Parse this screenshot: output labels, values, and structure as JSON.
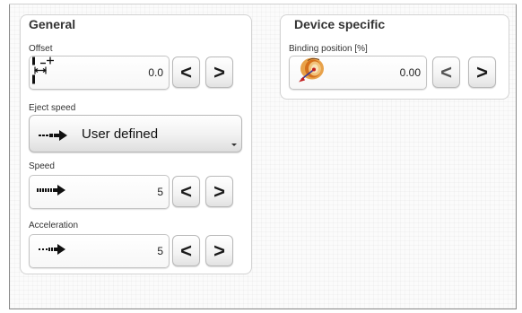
{
  "general": {
    "title": "General",
    "offset": {
      "label": "Offset",
      "value": "0.0",
      "icon": "offset-icon"
    },
    "eject_speed": {
      "label": "Eject speed",
      "selected": "User defined",
      "icon": "eject-speed-icon"
    },
    "speed": {
      "label": "Speed",
      "value": "5",
      "icon": "speed-icon"
    },
    "acceleration": {
      "label": "Acceleration",
      "value": "5",
      "icon": "acceleration-icon"
    }
  },
  "device_specific": {
    "title": "Device specific",
    "binding_position": {
      "label": "Binding position [%]",
      "value": "0.00",
      "icon": "binding-position-icon"
    }
  },
  "buttons": {
    "decrement": "<",
    "increment": ">"
  }
}
